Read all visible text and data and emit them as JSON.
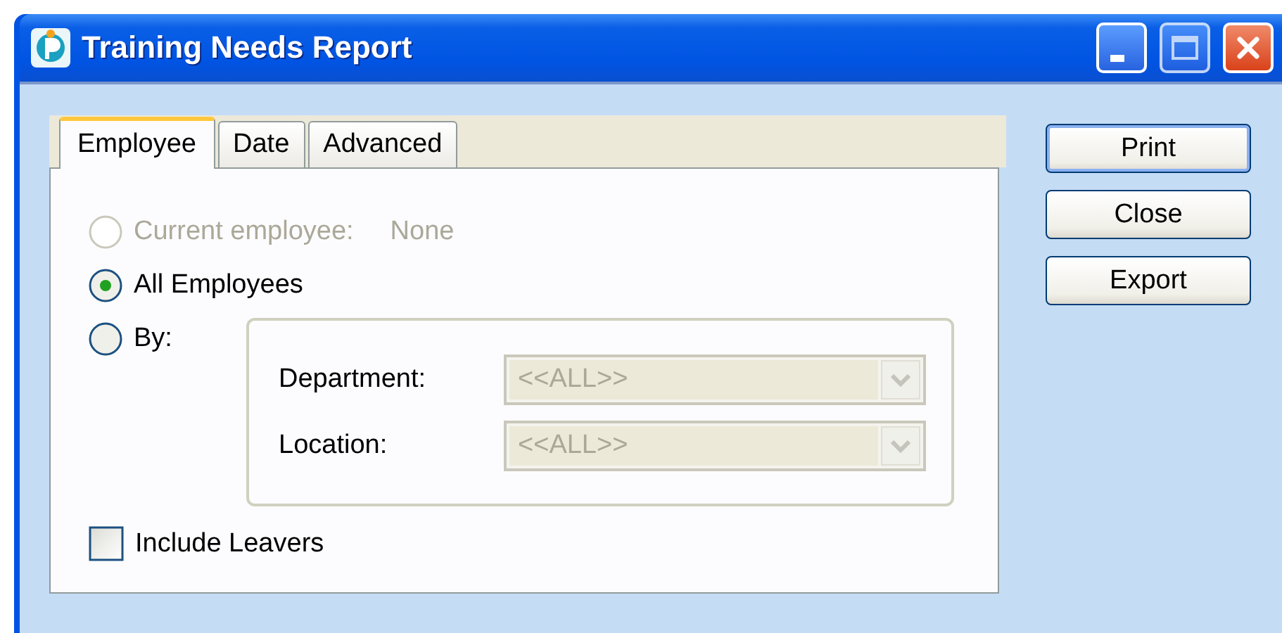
{
  "window": {
    "title": "Training Needs Report"
  },
  "tabs": [
    {
      "label": "Employee",
      "selected": true
    },
    {
      "label": "Date",
      "selected": false
    },
    {
      "label": "Advanced",
      "selected": false
    }
  ],
  "options": [
    {
      "label": "Current employee:",
      "value": "None",
      "selected": false,
      "disabled": true
    },
    {
      "label": "All Employees",
      "selected": true,
      "disabled": false
    },
    {
      "label": "By:",
      "selected": false,
      "disabled": false
    }
  ],
  "filters": [
    {
      "label": "Department:",
      "value": "<<ALL>>",
      "disabled": true
    },
    {
      "label": "Location:",
      "value": "<<ALL>>",
      "disabled": true
    }
  ],
  "include_leavers": {
    "label": "Include Leavers",
    "checked": false
  },
  "buttons": [
    {
      "label": "Print",
      "default": true
    },
    {
      "label": "Close",
      "default": false
    },
    {
      "label": "Export",
      "default": false
    }
  ]
}
